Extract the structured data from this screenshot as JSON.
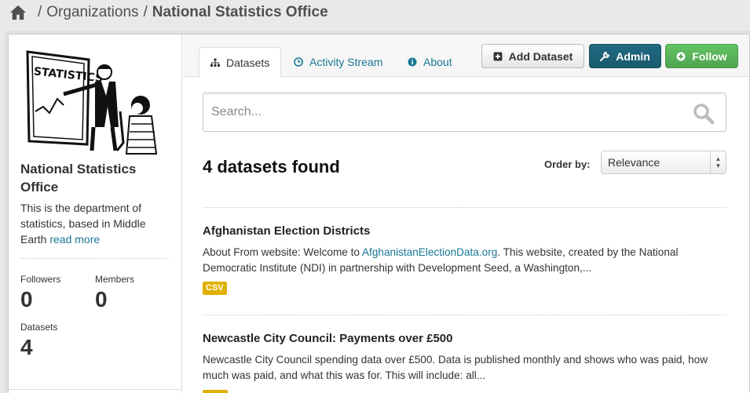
{
  "breadcrumb": {
    "home_icon": "home-icon",
    "separator": "/",
    "organizations": "Organizations",
    "current": "National Statistics Office"
  },
  "sidebar": {
    "image_alt": "STATISTICS",
    "title": "National Statistics Office",
    "description": "This is the department of statistics, based in Middle Earth",
    "read_more": "read more",
    "stats": {
      "followers_label": "Followers",
      "followers_value": "0",
      "members_label": "Members",
      "members_value": "0",
      "datasets_label": "Datasets",
      "datasets_value": "4"
    }
  },
  "tabs": [
    {
      "label": "Datasets",
      "icon": "sitemap-icon",
      "active": true
    },
    {
      "label": "Activity Stream",
      "icon": "clock-icon",
      "active": false
    },
    {
      "label": "About",
      "icon": "info-icon",
      "active": false
    }
  ],
  "actions": {
    "add_dataset": "Add Dataset",
    "admin": "Admin",
    "follow": "Follow"
  },
  "search": {
    "placeholder": "Search...",
    "value": ""
  },
  "results": {
    "count_text": "4 datasets found",
    "order_label": "Order by:",
    "order_selected": "Relevance"
  },
  "datasets": [
    {
      "title": "Afghanistan Election Districts",
      "notes_before": "About From website: Welcome to ",
      "notes_link": "AfghanistanElectionData.org",
      "notes_after": ". This website, created by the National Democratic Institute (NDI) in partnership with Development Seed, a Washington,...",
      "format": "CSV"
    },
    {
      "title": "Newcastle City Council: Payments over £500",
      "notes_before": "Newcastle City Council spending data over £500. Data is published monthly and shows who was paid, how much was paid, and what this was for. This will include: all...",
      "notes_link": "",
      "notes_after": "",
      "format": ""
    }
  ],
  "colors": {
    "link": "#187794",
    "admin": "#1f6a80",
    "follow": "#5bb75b",
    "csv_badge": "#dfb100"
  }
}
